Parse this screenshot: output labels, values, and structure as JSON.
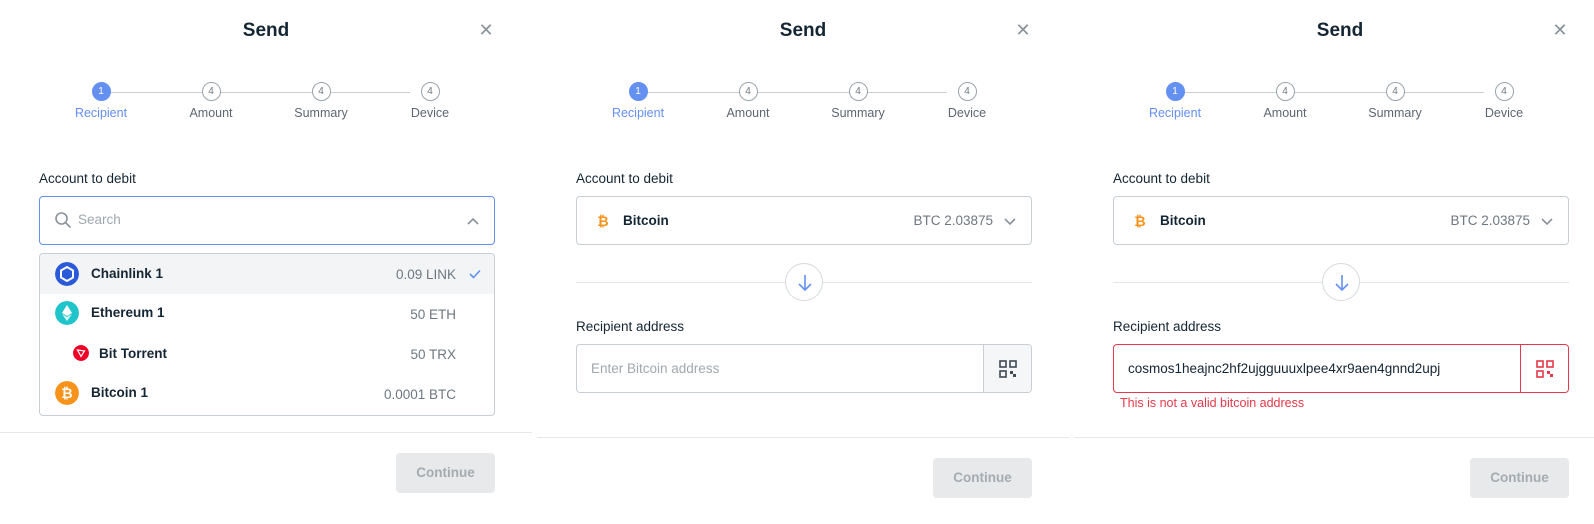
{
  "colors": {
    "accent": "#6490f1",
    "error": "#e5384a",
    "bitcoin": "#f7931a",
    "chainlink": "#2a5ada",
    "ethereum": "#20c4cb",
    "tron": "#ef0027"
  },
  "panels": [
    {
      "title": "Send",
      "steps": [
        {
          "num": "1",
          "label": "Recipient",
          "active": true
        },
        {
          "num": "4",
          "label": "Amount"
        },
        {
          "num": "4",
          "label": "Summary"
        },
        {
          "num": "4",
          "label": "Device"
        }
      ],
      "account_label": "Account to debit",
      "search_placeholder": "Search",
      "dropdown": [
        {
          "name": "Chainlink 1",
          "balance": "0.09 LINK",
          "icon": "chainlink-icon",
          "selected": true
        },
        {
          "name": "Ethereum 1",
          "balance": "50 ETH",
          "icon": "ethereum-icon"
        },
        {
          "name": "Bit Torrent",
          "balance": "50 TRX",
          "icon": "tron-icon",
          "sub": true
        },
        {
          "name": "Bitcoin 1",
          "balance": "0.0001 BTC",
          "icon": "bitcoin-icon"
        }
      ],
      "continue_label": "Continue"
    },
    {
      "title": "Send",
      "steps": [
        {
          "num": "1",
          "label": "Recipient",
          "active": true
        },
        {
          "num": "4",
          "label": "Amount"
        },
        {
          "num": "4",
          "label": "Summary"
        },
        {
          "num": "4",
          "label": "Device"
        }
      ],
      "account_label": "Account to debit",
      "account": {
        "name": "Bitcoin",
        "balance": "BTC 2.03875"
      },
      "recipient_label": "Recipient address",
      "recipient_placeholder": "Enter Bitcoin address",
      "recipient_value": "",
      "continue_label": "Continue"
    },
    {
      "title": "Send",
      "steps": [
        {
          "num": "1",
          "label": "Recipient",
          "active": true
        },
        {
          "num": "4",
          "label": "Amount"
        },
        {
          "num": "4",
          "label": "Summary"
        },
        {
          "num": "4",
          "label": "Device"
        }
      ],
      "account_label": "Account to debit",
      "account": {
        "name": "Bitcoin",
        "balance": "BTC 2.03875"
      },
      "recipient_label": "Recipient address",
      "recipient_placeholder": "Enter Bitcoin address",
      "recipient_value": "cosmos1heajnc2hf2ujgguuuxlpee4xr9aen4gnnd2upj",
      "error_text": "This is not a valid bitcoin address",
      "continue_label": "Continue"
    }
  ]
}
